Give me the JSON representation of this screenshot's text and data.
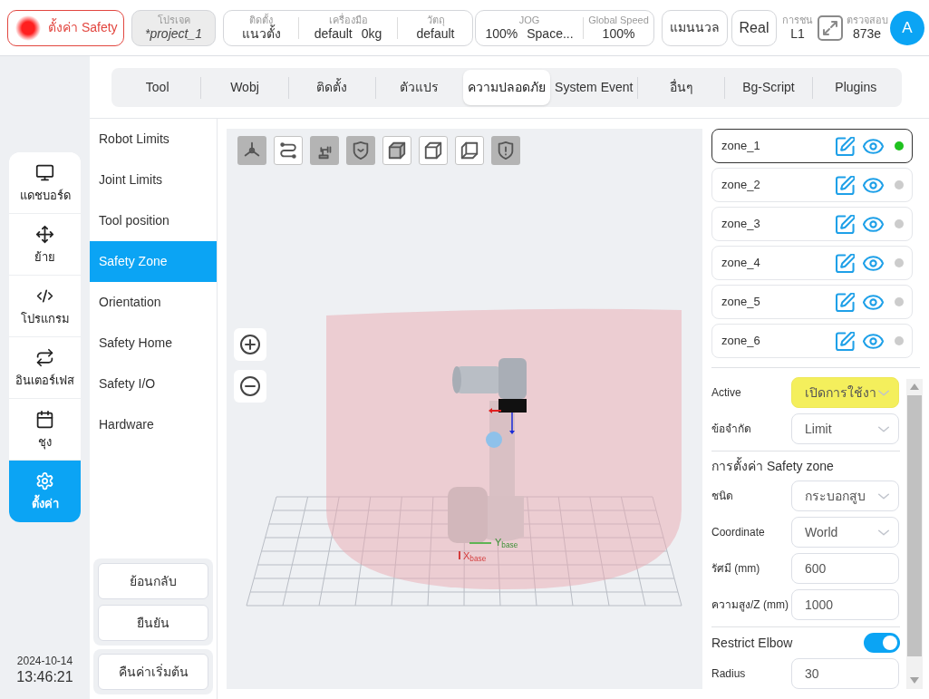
{
  "top_bar": {
    "safety_button": "ตั้งค่า Safety",
    "project": {
      "caption": "โปรเจค",
      "value": "*project_1"
    },
    "setup": [
      {
        "caption": "ติดตั้ง",
        "values": [
          "แนวตั้ง"
        ]
      },
      {
        "caption": "เครื่องมือ",
        "values": [
          "default",
          "0kg"
        ]
      },
      {
        "caption": "วัตถุ",
        "values": [
          "default"
        ]
      }
    ],
    "speed": [
      {
        "caption": "JOG",
        "values": [
          "100%",
          "Space..."
        ]
      },
      {
        "caption": "Global Speed",
        "values": [
          "100%"
        ]
      }
    ],
    "mode_button": "แมนนวล",
    "run_button": "Real",
    "collision": {
      "caption": "การชน",
      "value": "L1"
    },
    "check": {
      "caption": "ตรวจสอบ",
      "value": "873e"
    },
    "avatar": "A"
  },
  "nav": [
    {
      "label": "แดชบอร์ด",
      "selected": false
    },
    {
      "label": "ย้าย",
      "selected": false
    },
    {
      "label": "โปรแกรม",
      "selected": false
    },
    {
      "label": "อินเตอร์เฟส",
      "selected": false
    },
    {
      "label": "ชุง",
      "selected": false
    },
    {
      "label": "ตั้งค่า",
      "selected": true
    }
  ],
  "clock": {
    "date": "2024-10-14",
    "time": "13:46:21"
  },
  "tabs": [
    {
      "label": "Tool",
      "selected": false
    },
    {
      "label": "Wobj",
      "selected": false
    },
    {
      "label": "ติดตั้ง",
      "selected": false
    },
    {
      "label": "ตัวแปร",
      "selected": false
    },
    {
      "label": "ความปลอดภัย",
      "selected": true
    },
    {
      "label": "System Event",
      "selected": false
    },
    {
      "label": "อื่นๆ",
      "selected": false
    },
    {
      "label": "Bg-Script",
      "selected": false
    },
    {
      "label": "Plugins",
      "selected": false
    }
  ],
  "submenu": [
    {
      "label": "Robot Limits",
      "selected": false
    },
    {
      "label": "Joint Limits",
      "selected": false
    },
    {
      "label": "Tool position",
      "selected": false
    },
    {
      "label": "Safety Zone",
      "selected": true
    },
    {
      "label": "Orientation",
      "selected": false
    },
    {
      "label": "Safety Home",
      "selected": false
    },
    {
      "label": "Safety I/O",
      "selected": false
    },
    {
      "label": "Hardware",
      "selected": false
    }
  ],
  "actions": [
    {
      "label": "ย้อนกลับ"
    },
    {
      "label": "ยืนยัน"
    }
  ],
  "reset_button": "คืนค่าเริ่มต้น",
  "viewport": {
    "toolbar": [
      {
        "on": true
      },
      {
        "on": false
      },
      {
        "on": true
      },
      {
        "on": true
      },
      {
        "on": false
      },
      {
        "on": false
      },
      {
        "on": false
      },
      {
        "on": true
      }
    ],
    "axis_labels": [
      "X$_{base}$",
      "Y$_{base}$"
    ]
  },
  "zones": [
    {
      "label": "zone_1",
      "selected": true,
      "color": "#1fc21f"
    },
    {
      "label": "zone_2",
      "selected": false,
      "color": "#cccccc"
    },
    {
      "label": "zone_3",
      "selected": false,
      "color": "#cccccc"
    },
    {
      "label": "zone_4",
      "selected": false,
      "color": "#cccccc"
    },
    {
      "label": "zone_5",
      "selected": false,
      "color": "#cccccc"
    },
    {
      "label": "zone_6",
      "selected": false,
      "color": "#cccccc"
    }
  ],
  "zone_settings": {
    "general": [
      {
        "kind": "select",
        "label": "Active",
        "value": "เปิดการใช้งา",
        "highlighted": true
      },
      {
        "kind": "select",
        "label": "ข้อจำกัด",
        "value": "Limit",
        "highlighted": false
      }
    ],
    "zone_section": {
      "title": "การตั้งค่า Safety zone",
      "fields": [
        {
          "kind": "select",
          "label": "ชนิด",
          "value": "กระบอกสูบ",
          "highlighted": false
        },
        {
          "kind": "select",
          "label": "Coordinate",
          "value": "World",
          "highlighted": false
        },
        {
          "kind": "input",
          "label": "รัศมี (mm)",
          "value": "600"
        },
        {
          "kind": "input",
          "label": "ความสูง/Z (mm)",
          "value": "1000"
        }
      ]
    },
    "elbow_section": {
      "toggle": {
        "label": "Restrict Elbow",
        "on": true
      },
      "fields": [
        {
          "kind": "input",
          "label": "Radius",
          "value": "30"
        }
      ]
    }
  }
}
